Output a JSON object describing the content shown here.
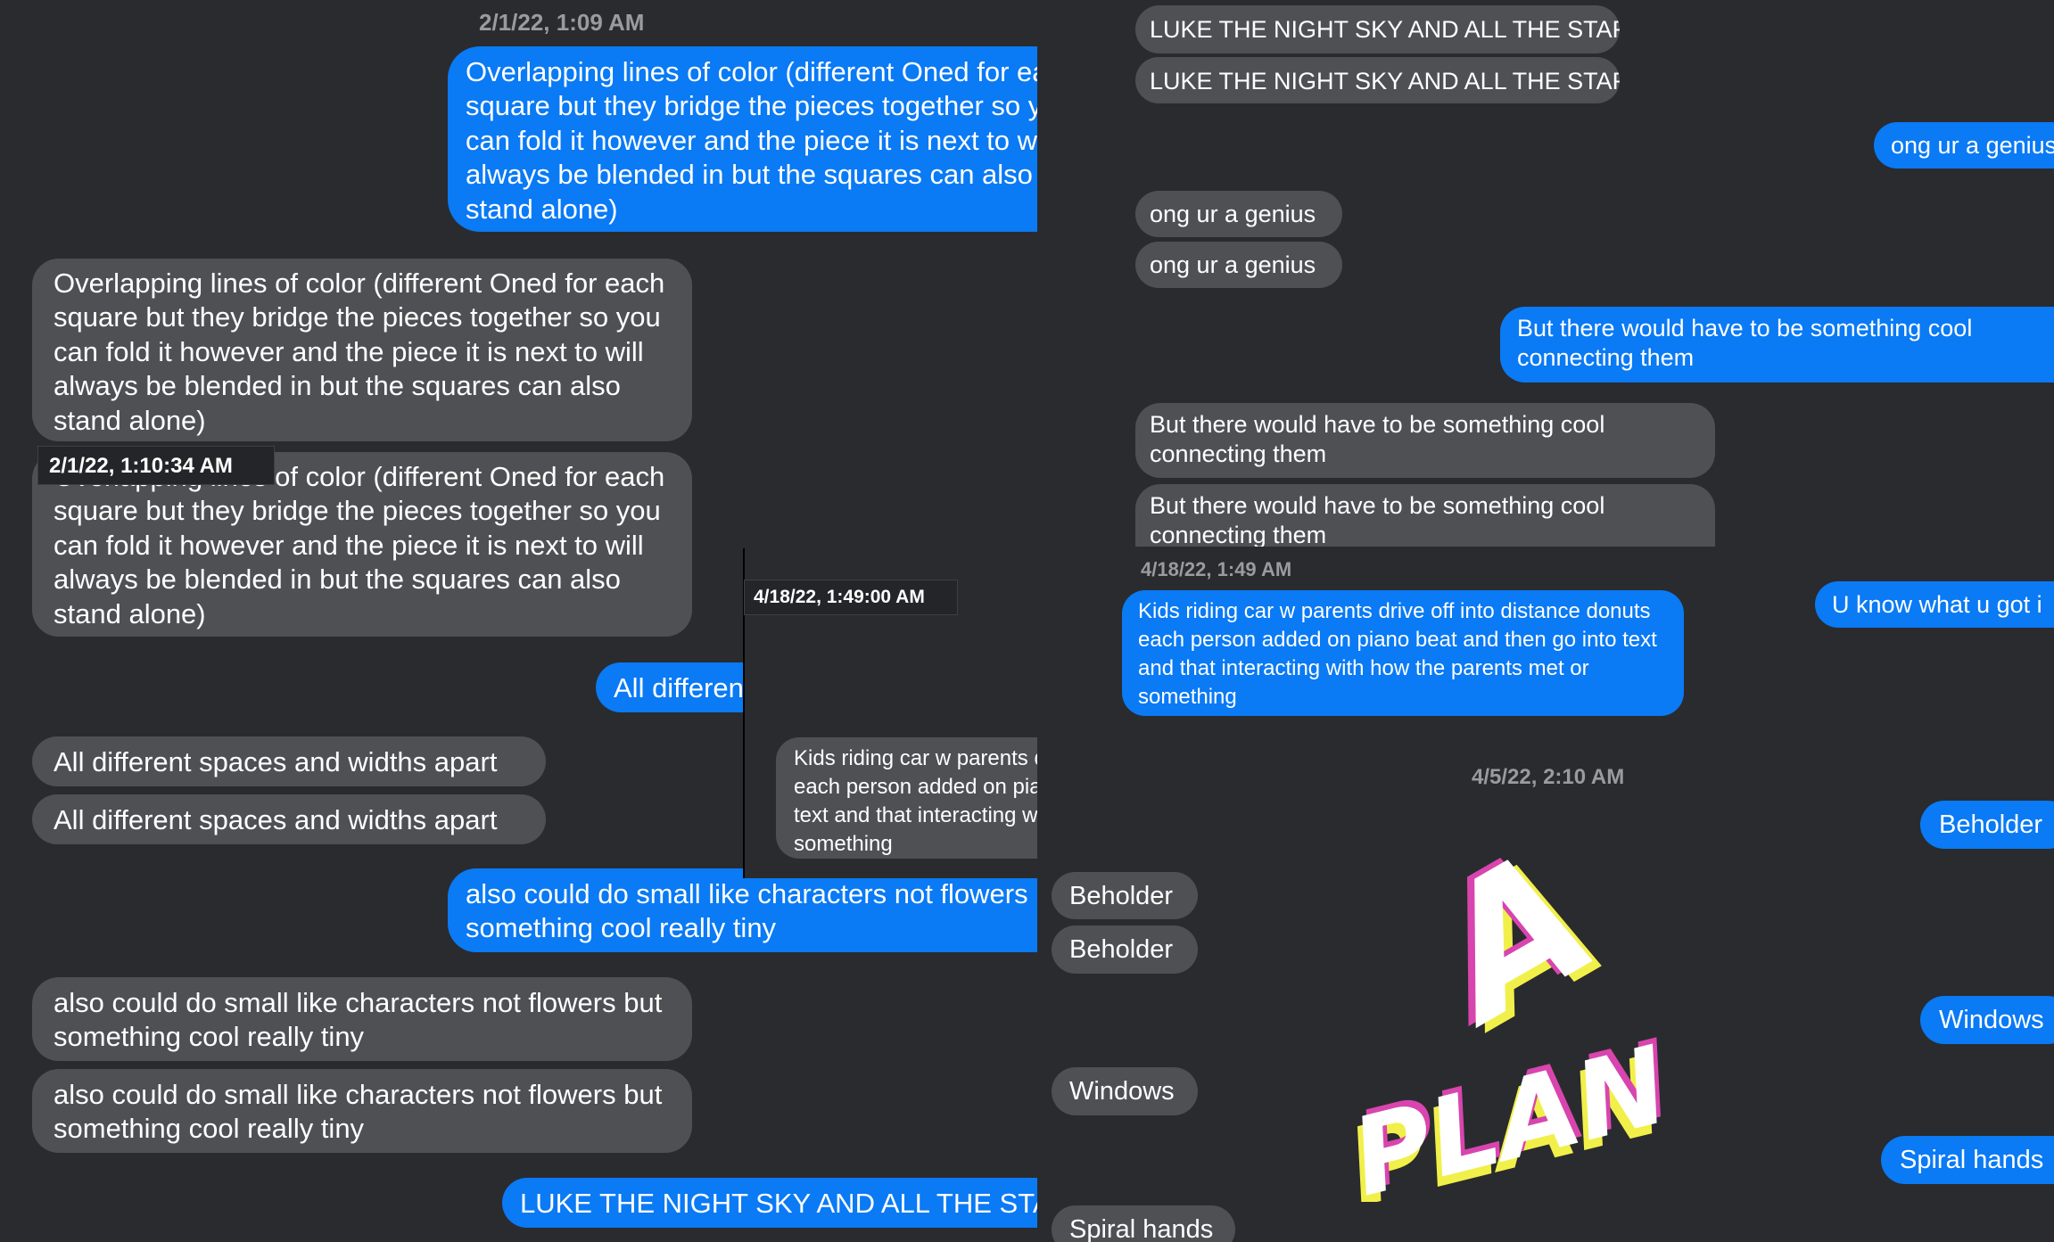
{
  "left_panel": {
    "timestamp_header": "2/1/22, 1:09 AM",
    "hover_timestamp": "2/1/22, 1:10:34 AM",
    "sent_overlapping": "Overlapping lines of color (different Oned for each square but they bridge the pieces together so you can fold it however and the piece it is next to will always be blended in but the squares can also stand alone)",
    "recv_overlapping_1": "Overlapping lines of color (different Oned for each square but they bridge the pieces together so you can fold it however and the piece it is next to will always be blended in but the squares can also stand alone)",
    "recv_overlapping_2": "Overlapping lines of color (different Oned for each square but they bridge the pieces together so you can fold it however and the piece it is next to will always be blended in but the squares can also stand alone)",
    "sent_spaces": "All different spaces and widths apart",
    "recv_spaces_1": "All different spaces and widths apart",
    "recv_spaces_2": "All different spaces and widths apart",
    "sent_small": "also could do small like characters not flowers but something cool really tiny",
    "recv_small_1": "also could do small like characters not flowers but something cool really tiny",
    "recv_small_2": "also could do small like characters not flowers but something cool really tiny",
    "sent_luke": "LUKE THE NIGHT SKY AND ALL THE STARS"
  },
  "middle_panel": {
    "hover_timestamp": "4/18/22, 1:49:00 AM",
    "recv_kids": "Kids riding car w parents drive off into distance donuts each person added on piano beat and then go into text and that interacting with how the parents met or something"
  },
  "top_right_panel": {
    "recv_luke_1": "LUKE THE NIGHT SKY AND ALL THE STARS",
    "recv_luke_2": "LUKE THE NIGHT SKY AND ALL THE STARS",
    "sent_genius": "ong ur a genius",
    "recv_genius_1": "ong ur a genius",
    "recv_genius_2": "ong ur a genius",
    "sent_cool": "But there would have to be something cool connecting them",
    "recv_cool_1": "But there would have to be something cool connecting them",
    "recv_cool_2": "But there would have to be something cool connecting them",
    "timestamp_header": "4/18/22, 1:49 AM",
    "sent_kids": "Kids riding car w parents drive off into distance donuts each person added on piano beat and then go into text and that interacting with how the parents met or something",
    "sent_know": "U know what u got i"
  },
  "bottom_right_panel": {
    "timestamp_header": "4/5/22, 2:10 AM",
    "recv_beholder_1": "Beholder",
    "recv_beholder_2": "Beholder",
    "recv_windows": "Windows",
    "recv_spiral": "Spiral hands",
    "sent_beholder": "Beholder",
    "sent_windows": "Windows",
    "sent_spiral": "Spiral hands",
    "sticker_line1": "A",
    "sticker_line2": "PLAN"
  },
  "colors": {
    "background": "#2a2b2e",
    "sent_bubble": "#0a7af5",
    "received_bubble": "#4f5054",
    "timestamp": "#9a9ba0",
    "sticker_pink": "#d845ae",
    "sticker_yellow": "#f1f04a"
  }
}
